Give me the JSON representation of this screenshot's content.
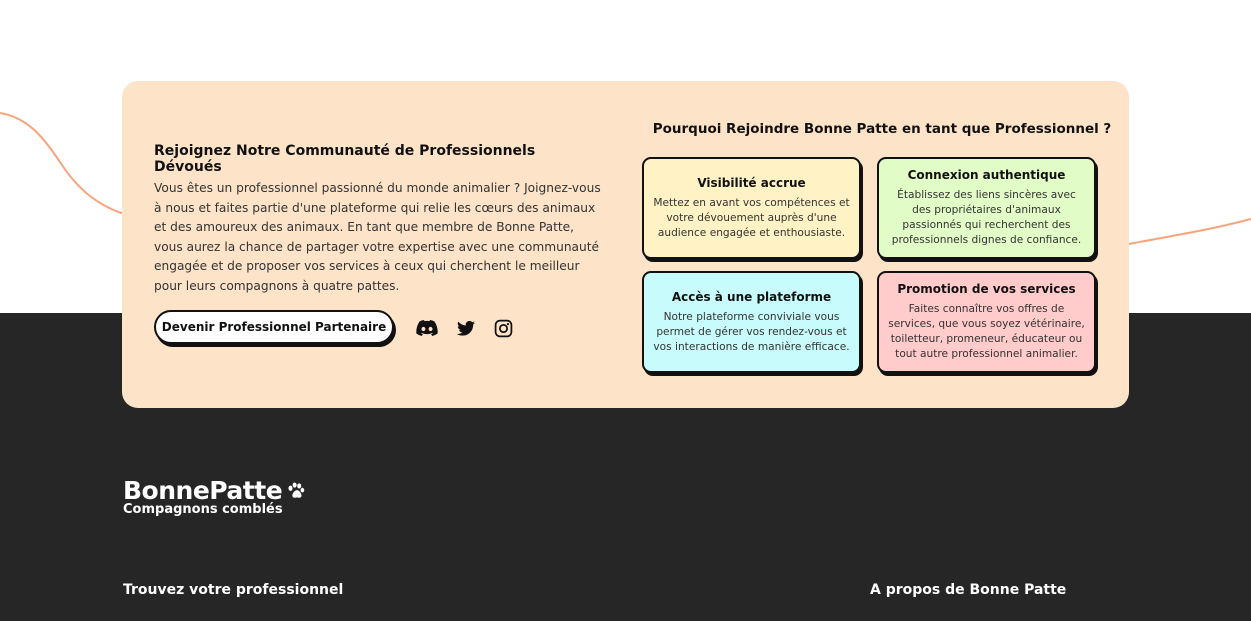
{
  "community": {
    "title": "Rejoignez Notre Communauté de Professionnels Dévoués",
    "description": "Vous êtes un professionnel passionné du monde animalier ? Joignez-vous à nous et faites partie d'une plateforme qui relie les cœurs des animaux et des amoureux des animaux. En tant que membre de Bonne Patte, vous aurez la chance de partager votre expertise avec une communauté engagée et de proposer vos services à ceux qui cherchent le meilleur pour leurs compagnons à quatre pattes.",
    "cta_label": "Devenir Professionnel Partenaire",
    "social_icons": [
      "discord-icon",
      "twitter-icon",
      "instagram-icon"
    ]
  },
  "why": {
    "title": "Pourquoi Rejoindre Bonne Patte en tant que Professionnel ?",
    "features": [
      {
        "title": "Visibilité accrue",
        "text": "Mettez en avant vos compétences et votre dévouement auprès d'une audience engagée et enthousiaste.",
        "color": "#fff2c4"
      },
      {
        "title": "Connexion authentique",
        "text": "Établissez des liens sincères avec des propriétaires d'animaux passionnés qui recherchent des professionnels dignes de confiance.",
        "color": "#e2fcc7"
      },
      {
        "title": "Accès à une plateforme",
        "text": "Notre plateforme conviviale vous permet de gérer vos rendez-vous et vos interactions de manière efficace.",
        "color": "#c8fbfb"
      },
      {
        "title": "Promotion de vos services",
        "text": "Faites connaître vos offres de services, que vous soyez vétérinaire, toiletteur, promeneur, éducateur ou tout autre professionnel animalier.",
        "color": "#ffcbcb"
      }
    ]
  },
  "footer": {
    "brand": "BonnePatte",
    "tagline": "Compagnons comblés",
    "col1_title": "Trouvez votre professionnel",
    "col2_title": "A propos de Bonne Patte"
  },
  "colors": {
    "card_bg": "#fde3c8",
    "footer_bg": "#262626",
    "wave": "#f7a47c"
  }
}
